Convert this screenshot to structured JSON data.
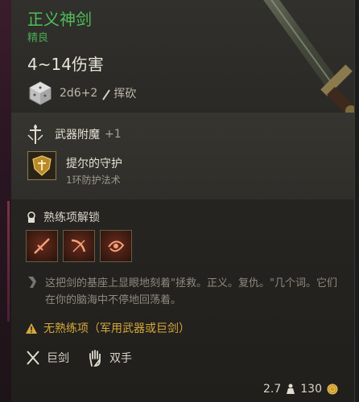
{
  "item": {
    "name": "正义神剑",
    "rarity": "精良",
    "damage": "4~14伤害",
    "dice": "2d6+2",
    "damage_type": "挥砍"
  },
  "enchantment": {
    "title": "武器附魔",
    "bonus": "+1",
    "spell_name": "提尔的守护",
    "spell_sub": "1环防护法术"
  },
  "proficiency": {
    "title": "熟练项解锁",
    "icons": [
      "cleaving-strike-icon",
      "lacerate-icon",
      "rush-attack-icon"
    ]
  },
  "description": "这把剑的基座上显眼地刻着\"拯救。正义。复仇。\"几个词。它们在你的脑海中不停地回荡着。",
  "warning": "无熟练项（军用武器或巨剑）",
  "properties": [
    {
      "icon": "greatsword-icon",
      "label": "巨剑"
    },
    {
      "icon": "two-handed-icon",
      "label": "双手"
    }
  ],
  "footer": {
    "weight": "2.7",
    "value": "130"
  },
  "colors": {
    "name": "#4fbf5a",
    "warning": "#d6a83a"
  }
}
